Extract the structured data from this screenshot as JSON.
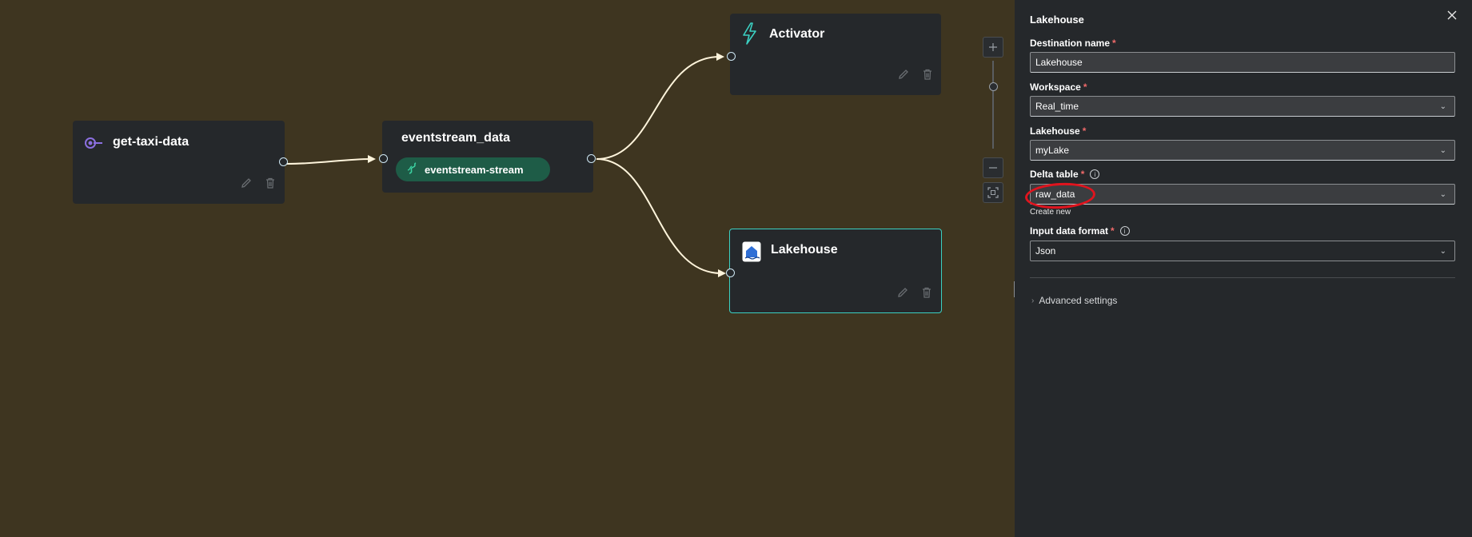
{
  "canvas": {
    "nodes": {
      "source": {
        "title": "get-taxi-data",
        "icon": "source-plug-icon"
      },
      "eventstream": {
        "title": "eventstream_data",
        "stream_label": "eventstream-stream",
        "icon": "stream-icon"
      },
      "activator": {
        "title": "Activator",
        "icon": "lightning-icon"
      },
      "lakehouse": {
        "title": "Lakehouse",
        "icon": "lakehouse-icon"
      }
    },
    "zoom": {
      "level": 0.5
    }
  },
  "panel": {
    "title": "Lakehouse",
    "fields": {
      "destination_name": {
        "label": "Destination name",
        "value": "Lakehouse"
      },
      "workspace": {
        "label": "Workspace",
        "value": "Real_time"
      },
      "lakehouse": {
        "label": "Lakehouse",
        "value": "myLake"
      },
      "delta_table": {
        "label": "Delta table",
        "value": "raw_data",
        "create_new": "Create new"
      },
      "input_format": {
        "label": "Input data format",
        "value": "Json"
      }
    },
    "advanced_label": "Advanced settings"
  },
  "colors": {
    "canvas_bg": "#3e3520",
    "node_bg": "#25282b",
    "selected_border": "#3bd0c2",
    "stream_chip": "#1e5c47",
    "annotation": "#e0141e"
  }
}
